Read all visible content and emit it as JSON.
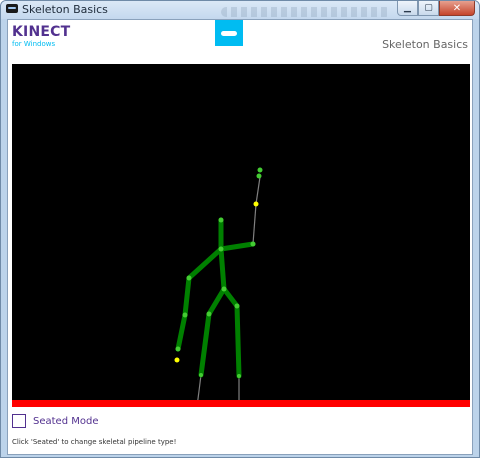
{
  "window": {
    "title": "Skeleton Basics"
  },
  "header": {
    "logo_main": "KINECT",
    "logo_sub": "for Windows",
    "app_title": "Skeleton Basics"
  },
  "controls": {
    "seated_mode_label": "Seated Mode",
    "seated_mode_checked": false
  },
  "status_bar": {
    "text": "Click 'Seated' to change skeletal pipeline type!"
  },
  "colors": {
    "accent": "#52318f",
    "kinect_blue": "#00bcf2",
    "bone_tracked": "#008000",
    "joint_tracked": "#44cc33",
    "joint_inferred": "#ffff00",
    "bone_inferred": "#808080",
    "clip_edge": "#ff0000"
  },
  "icons": {
    "window_icon": "kinect-sensor-icon",
    "minimize": "minimize-icon",
    "maximize": "maximize-icon",
    "close": "close-icon"
  }
}
